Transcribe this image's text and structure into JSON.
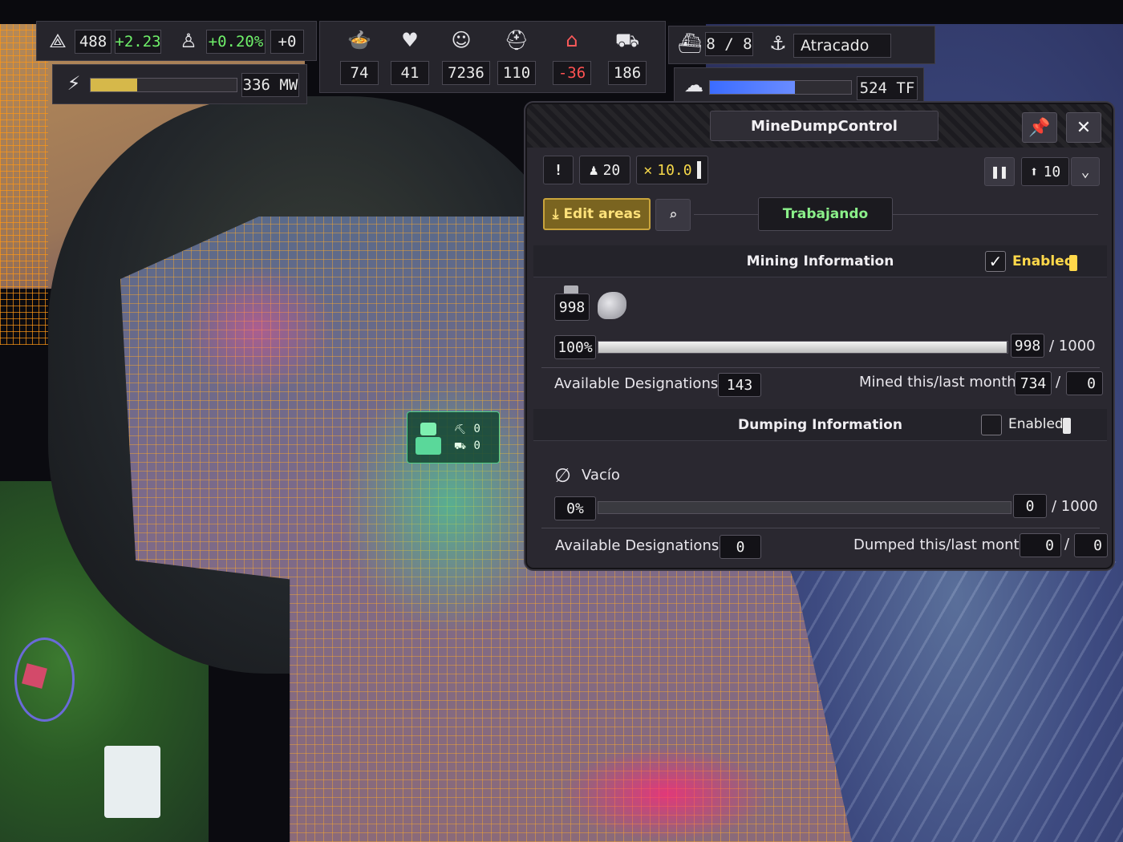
{
  "hud": {
    "unity": "488",
    "unity_delta": "+2.23",
    "pop_growth": "+0.20%",
    "pop_extra": "+0",
    "power_fill": 0.32,
    "power_value": "336 MW",
    "stats": [
      {
        "icon": "food-icon",
        "value": "74",
        "negative": false
      },
      {
        "icon": "health-icon",
        "value": "41",
        "negative": false
      },
      {
        "icon": "population-icon",
        "value": "7236",
        "negative": false
      },
      {
        "icon": "workers-icon",
        "value": "110",
        "negative": false
      },
      {
        "icon": "housing-icon",
        "value": "-36",
        "negative": true
      },
      {
        "icon": "trucks-icon",
        "value": "186",
        "negative": false
      }
    ],
    "ships": "8 / 8",
    "ship_status": "Atracado",
    "compute_fill": 0.6,
    "compute_value": "524 TF"
  },
  "marker": {
    "excavators": "0",
    "trucks": "0"
  },
  "window": {
    "title": "MineDumpControl",
    "workers": "20",
    "maintenance": "10.0",
    "priority": "10",
    "edit_areas": "Edit areas",
    "status": "Trabajando",
    "mining": {
      "title": "Mining Information",
      "enabled_label": "Enabled",
      "enabled": true,
      "product_count": "998",
      "percent": "100%",
      "fill": 0.998,
      "current": "998",
      "max": "/ 1000",
      "available_label": "Available Designations :",
      "available": "143",
      "mined_label": "Mined this/last month :",
      "mined_this": "734",
      "slash": "/",
      "mined_last": "0"
    },
    "dumping": {
      "title": "Dumping Information",
      "enabled_label": "Enabled",
      "enabled": false,
      "empty_label": "Vacío",
      "percent": "0%",
      "fill": 0,
      "current": "0",
      "max": "/ 1000",
      "available_label": "Available Designations :",
      "available": "0",
      "dumped_label": "Dumped this/last month :",
      "dumped_this": "0",
      "slash": "/",
      "dumped_last": "0"
    }
  },
  "colors": {
    "positive": "#6ff06a",
    "negative": "#ff5252",
    "status": "#8bf08a",
    "accent_gold": "#c9a43c"
  }
}
